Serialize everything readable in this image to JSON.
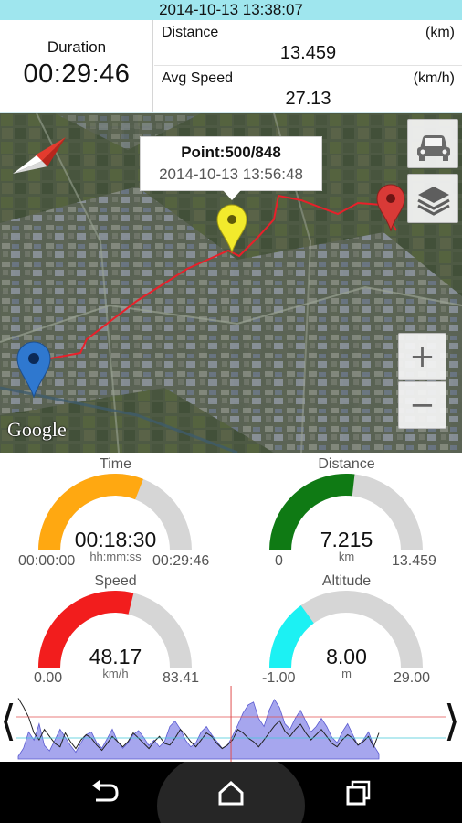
{
  "status": {
    "timestamp": "2014-10-13 13:38:07"
  },
  "summary": {
    "duration_label": "Duration",
    "duration_value": "00:29:46",
    "distance_label": "Distance",
    "distance_unit": "(km)",
    "distance_value": "13.459",
    "avg_speed_label": "Avg Speed",
    "avg_speed_unit": "(km/h)",
    "avg_speed_value": "27.13"
  },
  "map": {
    "popup_title": "Point:500/848",
    "popup_time": "2014-10-13 13:56:48",
    "logo_text": "Google",
    "zoom_in_label": "+",
    "zoom_out_label": "−",
    "start_marker_color": "#2f78cf",
    "current_marker_color": "#f2ea2c",
    "end_marker_color": "#d93a37",
    "route_color": "#e8202a",
    "icons": {
      "car": "car-icon",
      "layers": "layers-icon",
      "compass": "compass-icon"
    }
  },
  "gauges": {
    "time": {
      "title": "Time",
      "value": "00:18:30",
      "unit": "hh:mm:ss",
      "min": "00:00:00",
      "max": "00:29:46",
      "fraction": 0.62,
      "color": "#ffa811"
    },
    "distance": {
      "title": "Distance",
      "value": "7.215",
      "unit": "km",
      "min": "0",
      "max": "13.459",
      "fraction": 0.536,
      "color": "#0f7a14"
    },
    "speed": {
      "title": "Speed",
      "value": "48.17",
      "unit": "km/h",
      "min": "0.00",
      "max": "83.41",
      "fraction": 0.578,
      "color": "#f21d1d"
    },
    "altitude": {
      "title": "Altitude",
      "value": "8.00",
      "unit": "m",
      "min": "-1.00",
      "max": "29.00",
      "fraction": 0.3,
      "color": "#1cf1f3"
    }
  },
  "profile": {
    "prev_arrow": "⟨",
    "next_arrow": "⟩",
    "fill_color": "#a6a6ee",
    "line_color": "#222222",
    "cursor_color": "#e05050",
    "cursor_fraction": 0.59,
    "altitude_series": [
      2,
      8,
      20,
      14,
      26,
      10,
      6,
      14,
      22,
      16,
      10,
      5,
      12,
      18,
      20,
      12,
      8,
      15,
      22,
      13,
      8,
      12,
      18,
      21,
      16,
      10,
      14,
      9,
      13,
      24,
      28,
      22,
      14,
      9,
      12,
      20,
      24,
      18,
      13,
      8,
      10,
      17,
      25,
      34,
      40,
      42,
      30,
      24,
      36,
      44,
      38,
      26,
      22,
      30,
      36,
      28,
      20,
      24,
      30,
      24,
      16,
      12,
      20,
      26,
      18,
      10,
      14,
      20,
      10,
      4
    ],
    "speed_series": [
      70,
      60,
      48,
      30,
      22,
      34,
      26,
      18,
      14,
      30,
      20,
      12,
      22,
      28,
      24,
      16,
      10,
      18,
      26,
      20,
      14,
      20,
      30,
      24,
      18,
      12,
      20,
      26,
      18,
      16,
      24,
      34,
      28,
      20,
      14,
      22,
      30,
      26,
      18,
      12,
      16,
      22,
      34,
      30,
      24,
      20,
      14,
      22,
      30,
      38,
      44,
      32,
      26,
      34,
      40,
      30,
      22,
      28,
      34,
      26,
      18,
      14,
      22,
      28,
      24,
      16,
      20,
      26,
      14,
      30
    ]
  },
  "navbar": {
    "back": "back-icon",
    "home": "home-icon",
    "recent": "recent-apps-icon"
  }
}
